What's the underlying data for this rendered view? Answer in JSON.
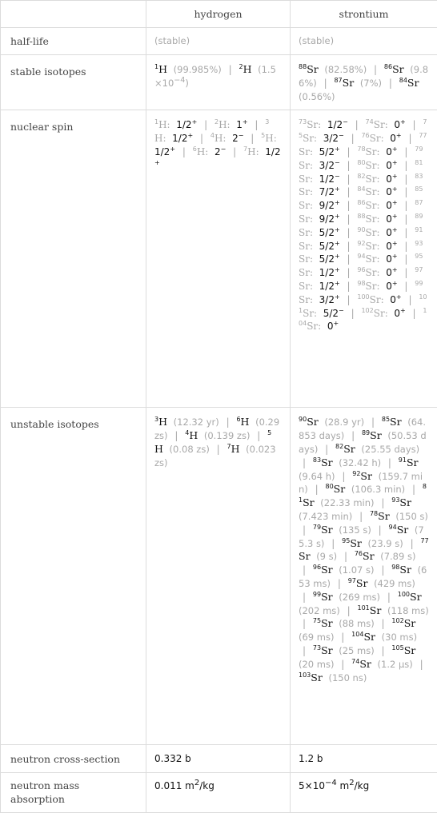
{
  "header": {
    "col0": "",
    "col1": "hydrogen",
    "col2": "strontium"
  },
  "rows": {
    "half_life": {
      "label": "half-life",
      "hydrogen": "(stable)",
      "strontium": "(stable)"
    },
    "stable_isotopes": {
      "label": "stable isotopes",
      "hydrogen": [
        {
          "mass": "1",
          "symbol": "H",
          "value": "(99.985%)"
        },
        {
          "mass": "2",
          "symbol": "H",
          "value": "(1.5×10",
          "exp": "−4",
          "value_end": ")"
        }
      ],
      "strontium": [
        {
          "mass": "88",
          "symbol": "Sr",
          "value": "(82.58%)"
        },
        {
          "mass": "86",
          "symbol": "Sr",
          "value": "(9.86%)"
        },
        {
          "mass": "87",
          "symbol": "Sr",
          "value": "(7%)"
        },
        {
          "mass": "84",
          "symbol": "Sr",
          "value": "(0.56%)"
        }
      ]
    },
    "nuclear_spin": {
      "label": "nuclear spin",
      "hydrogen": [
        {
          "mass": "1",
          "symbol": "H",
          "spin": "1/2",
          "parity": "+"
        },
        {
          "mass": "2",
          "symbol": "H",
          "spin": "1",
          "parity": "+"
        },
        {
          "mass": "3",
          "symbol": "H",
          "spin": "1/2",
          "parity": "+"
        },
        {
          "mass": "4",
          "symbol": "H",
          "spin": "2",
          "parity": "−"
        },
        {
          "mass": "5",
          "symbol": "H",
          "spin": "1/2",
          "parity": "+"
        },
        {
          "mass": "6",
          "symbol": "H",
          "spin": "2",
          "parity": "−"
        },
        {
          "mass": "7",
          "symbol": "H",
          "spin": "1/2",
          "parity": "+"
        }
      ],
      "strontium": [
        {
          "mass": "73",
          "symbol": "Sr",
          "spin": "1/2",
          "parity": "−"
        },
        {
          "mass": "74",
          "symbol": "Sr",
          "spin": "0",
          "parity": "+"
        },
        {
          "mass": "75",
          "symbol": "Sr",
          "spin": "3/2",
          "parity": "−"
        },
        {
          "mass": "76",
          "symbol": "Sr",
          "spin": "0",
          "parity": "+"
        },
        {
          "mass": "77",
          "symbol": "Sr",
          "spin": "5/2",
          "parity": "+"
        },
        {
          "mass": "78",
          "symbol": "Sr",
          "spin": "0",
          "parity": "+"
        },
        {
          "mass": "79",
          "symbol": "Sr",
          "spin": "3/2",
          "parity": "−"
        },
        {
          "mass": "80",
          "symbol": "Sr",
          "spin": "0",
          "parity": "+"
        },
        {
          "mass": "81",
          "symbol": "Sr",
          "spin": "1/2",
          "parity": "−"
        },
        {
          "mass": "82",
          "symbol": "Sr",
          "spin": "0",
          "parity": "+"
        },
        {
          "mass": "83",
          "symbol": "Sr",
          "spin": "7/2",
          "parity": "+"
        },
        {
          "mass": "84",
          "symbol": "Sr",
          "spin": "0",
          "parity": "+"
        },
        {
          "mass": "85",
          "symbol": "Sr",
          "spin": "9/2",
          "parity": "+"
        },
        {
          "mass": "86",
          "symbol": "Sr",
          "spin": "0",
          "parity": "+"
        },
        {
          "mass": "87",
          "symbol": "Sr",
          "spin": "9/2",
          "parity": "+"
        },
        {
          "mass": "88",
          "symbol": "Sr",
          "spin": "0",
          "parity": "+"
        },
        {
          "mass": "89",
          "symbol": "Sr",
          "spin": "5/2",
          "parity": "+"
        },
        {
          "mass": "90",
          "symbol": "Sr",
          "spin": "0",
          "parity": "+"
        },
        {
          "mass": "91",
          "symbol": "Sr",
          "spin": "5/2",
          "parity": "+"
        },
        {
          "mass": "92",
          "symbol": "Sr",
          "spin": "0",
          "parity": "+"
        },
        {
          "mass": "93",
          "symbol": "Sr",
          "spin": "5/2",
          "parity": "+"
        },
        {
          "mass": "94",
          "symbol": "Sr",
          "spin": "0",
          "parity": "+"
        },
        {
          "mass": "95",
          "symbol": "Sr",
          "spin": "1/2",
          "parity": "+"
        },
        {
          "mass": "96",
          "symbol": "Sr",
          "spin": "0",
          "parity": "+"
        },
        {
          "mass": "97",
          "symbol": "Sr",
          "spin": "1/2",
          "parity": "+"
        },
        {
          "mass": "98",
          "symbol": "Sr",
          "spin": "0",
          "parity": "+"
        },
        {
          "mass": "99",
          "symbol": "Sr",
          "spin": "3/2",
          "parity": "+"
        },
        {
          "mass": "100",
          "symbol": "Sr",
          "spin": "0",
          "parity": "+"
        },
        {
          "mass": "101",
          "symbol": "Sr",
          "spin": "5/2",
          "parity": "−"
        },
        {
          "mass": "102",
          "symbol": "Sr",
          "spin": "0",
          "parity": "+"
        },
        {
          "mass": "104",
          "symbol": "Sr",
          "spin": "0",
          "parity": "+"
        }
      ]
    },
    "unstable_isotopes": {
      "label": "unstable isotopes",
      "hydrogen": [
        {
          "mass": "3",
          "symbol": "H",
          "value": "(12.32 yr)"
        },
        {
          "mass": "6",
          "symbol": "H",
          "value": "(0.29 zs)"
        },
        {
          "mass": "4",
          "symbol": "H",
          "value": "(0.139 zs)"
        },
        {
          "mass": "5",
          "symbol": "H",
          "value": "(0.08 zs)"
        },
        {
          "mass": "7",
          "symbol": "H",
          "value": "(0.023 zs)"
        }
      ],
      "strontium": [
        {
          "mass": "90",
          "symbol": "Sr",
          "value": "(28.9 yr)"
        },
        {
          "mass": "85",
          "symbol": "Sr",
          "value": "(64.853 days)"
        },
        {
          "mass": "89",
          "symbol": "Sr",
          "value": "(50.53 days)"
        },
        {
          "mass": "82",
          "symbol": "Sr",
          "value": "(25.55 days)"
        },
        {
          "mass": "83",
          "symbol": "Sr",
          "value": "(32.42 h)"
        },
        {
          "mass": "91",
          "symbol": "Sr",
          "value": "(9.64 h)"
        },
        {
          "mass": "92",
          "symbol": "Sr",
          "value": "(159.7 min)"
        },
        {
          "mass": "80",
          "symbol": "Sr",
          "value": "(106.3 min)"
        },
        {
          "mass": "81",
          "symbol": "Sr",
          "value": "(22.33 min)"
        },
        {
          "mass": "93",
          "symbol": "Sr",
          "value": "(7.423 min)"
        },
        {
          "mass": "78",
          "symbol": "Sr",
          "value": "(150 s)"
        },
        {
          "mass": "79",
          "symbol": "Sr",
          "value": "(135 s)"
        },
        {
          "mass": "94",
          "symbol": "Sr",
          "value": "(75.3 s)"
        },
        {
          "mass": "95",
          "symbol": "Sr",
          "value": "(23.9 s)"
        },
        {
          "mass": "77",
          "symbol": "Sr",
          "value": "(9 s)"
        },
        {
          "mass": "76",
          "symbol": "Sr",
          "value": "(7.89 s)"
        },
        {
          "mass": "96",
          "symbol": "Sr",
          "value": "(1.07 s)"
        },
        {
          "mass": "98",
          "symbol": "Sr",
          "value": "(653 ms)"
        },
        {
          "mass": "97",
          "symbol": "Sr",
          "value": "(429 ms)"
        },
        {
          "mass": "99",
          "symbol": "Sr",
          "value": "(269 ms)"
        },
        {
          "mass": "100",
          "symbol": "Sr",
          "value": "(202 ms)"
        },
        {
          "mass": "101",
          "symbol": "Sr",
          "value": "(118 ms)"
        },
        {
          "mass": "75",
          "symbol": "Sr",
          "value": "(88 ms)"
        },
        {
          "mass": "102",
          "symbol": "Sr",
          "value": "(69 ms)"
        },
        {
          "mass": "104",
          "symbol": "Sr",
          "value": "(30 ms)"
        },
        {
          "mass": "73",
          "symbol": "Sr",
          "value": "(25 ms)"
        },
        {
          "mass": "105",
          "symbol": "Sr",
          "value": "(20 ms)"
        },
        {
          "mass": "74",
          "symbol": "Sr",
          "value": "(1.2 μs)"
        },
        {
          "mass": "103",
          "symbol": "Sr",
          "value": "(150 ns)"
        }
      ]
    },
    "neutron_cross_section": {
      "label": "neutron cross-section",
      "hydrogen": "0.332 b",
      "strontium": "1.2 b"
    },
    "neutron_mass_absorption": {
      "label": "neutron mass absorption",
      "hydrogen": {
        "value": "0.011 m",
        "exp": "2",
        "unit_end": "/kg"
      },
      "strontium": {
        "value": "5×10",
        "exp": "−4",
        "mid": " m",
        "exp2": "2",
        "unit_end": "/kg"
      }
    }
  },
  "separator": "|"
}
